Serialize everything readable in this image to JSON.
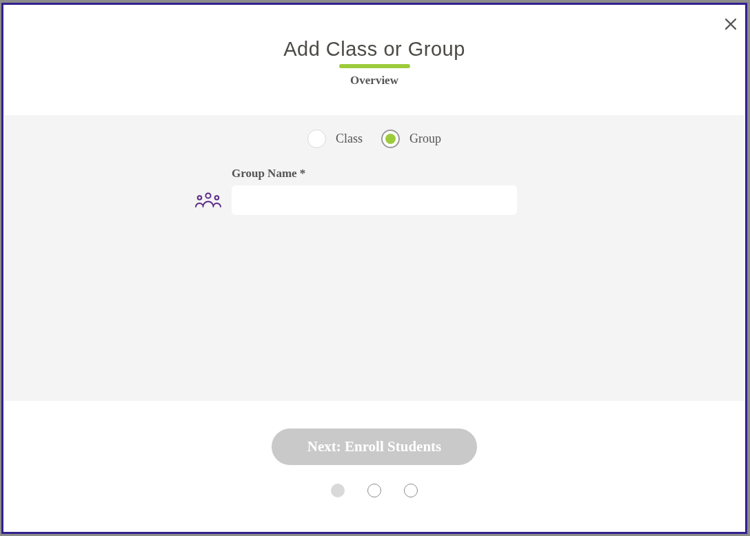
{
  "dialog": {
    "title": "Add Class or Group",
    "step_label": "Overview"
  },
  "type_options": [
    {
      "label": "Class",
      "selected": false
    },
    {
      "label": "Group",
      "selected": true
    }
  ],
  "group_name_field": {
    "label": "Group Name *"
  },
  "next_button": {
    "label": "Next: Enroll Students",
    "disabled": true
  },
  "steps": [
    {
      "selected": true
    },
    {
      "selected": false
    },
    {
      "selected": false
    }
  ]
}
